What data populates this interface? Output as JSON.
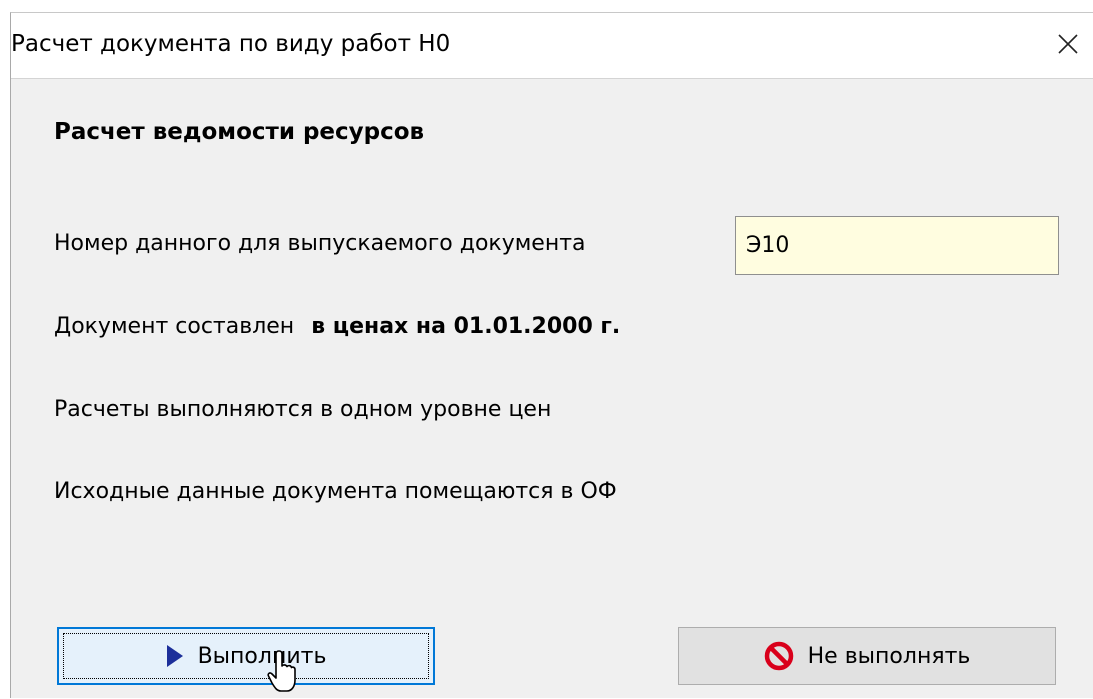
{
  "window": {
    "title": "Расчет документа по виду работ  Н0",
    "close_icon": "close-icon"
  },
  "dialog": {
    "heading": "Расчет ведомости ресурсов",
    "doc_number_label": "Номер данного для выпускаемого документа",
    "doc_number_value": "Э10",
    "prices_label": "Документ составлен",
    "prices_value": "в ценах на 01.01.2000 г.",
    "price_level_text": "Расчеты выполняются в одном уровне цен",
    "source_data_text": "Исходные данные документа помещаются в  ОФ"
  },
  "buttons": {
    "run_label": "Выполнить",
    "run_icon": "play-triangle-icon",
    "cancel_label": "Не выполнять",
    "cancel_icon": "no-entry-icon"
  },
  "colors": {
    "input_background": "#fffde0",
    "run_button_border": "#0078d7",
    "run_icon": "#1c2f9a",
    "cancel_icon": "#d9001b"
  }
}
